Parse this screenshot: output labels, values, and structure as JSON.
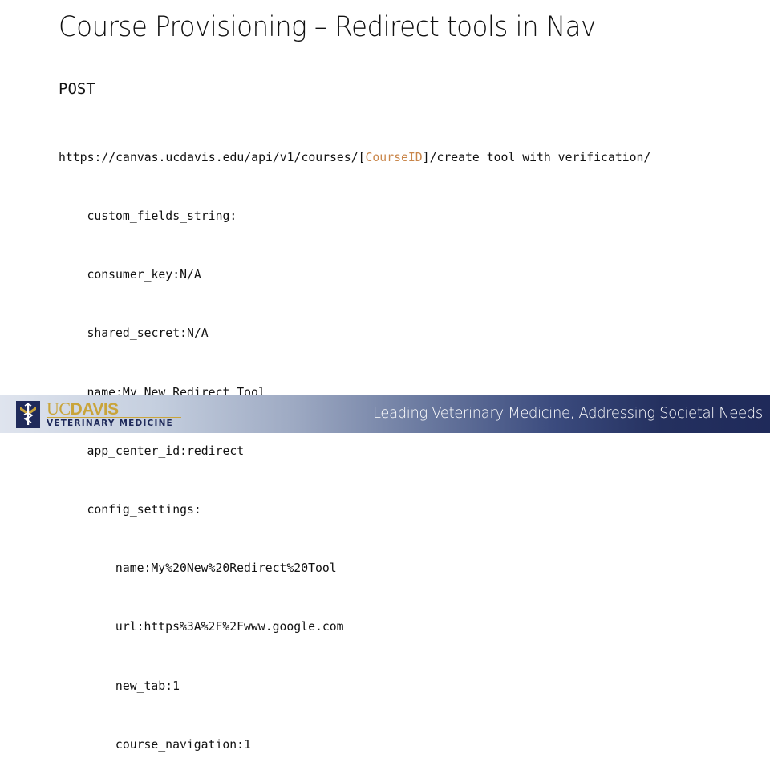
{
  "slide": {
    "title": "Course Provisioning – Redirect tools in Nav",
    "method": "POST",
    "endpoint": {
      "prefix": "https://canvas.ucdavis.edu/api/v1/courses/[",
      "placeholder": "CourseID",
      "suffix": "]/create_tool_with_verification/"
    },
    "params": [
      "custom_fields_string:",
      "consumer_key:N/A",
      "shared_secret:N/A",
      "name:My New Redirect Tool",
      "app_center_id:redirect",
      "config_settings:"
    ],
    "config_settings": [
      "name:My%20New%20Redirect%20Tool",
      "url:https%3A%2F%2Fwww.google.com",
      "new_tab:1",
      "course_navigation:1"
    ]
  },
  "footer": {
    "logo": {
      "uc": "UC",
      "davis": "DAVIS",
      "subtitle": "VETERINARY MEDICINE",
      "icon": "caduceus-shield-icon"
    },
    "tagline": "Leading Veterinary Medicine, Addressing Societal Needs"
  },
  "colors": {
    "placeholder": "#c9864a",
    "navy": "#1f2a5a",
    "gold": "#c9a43a"
  }
}
